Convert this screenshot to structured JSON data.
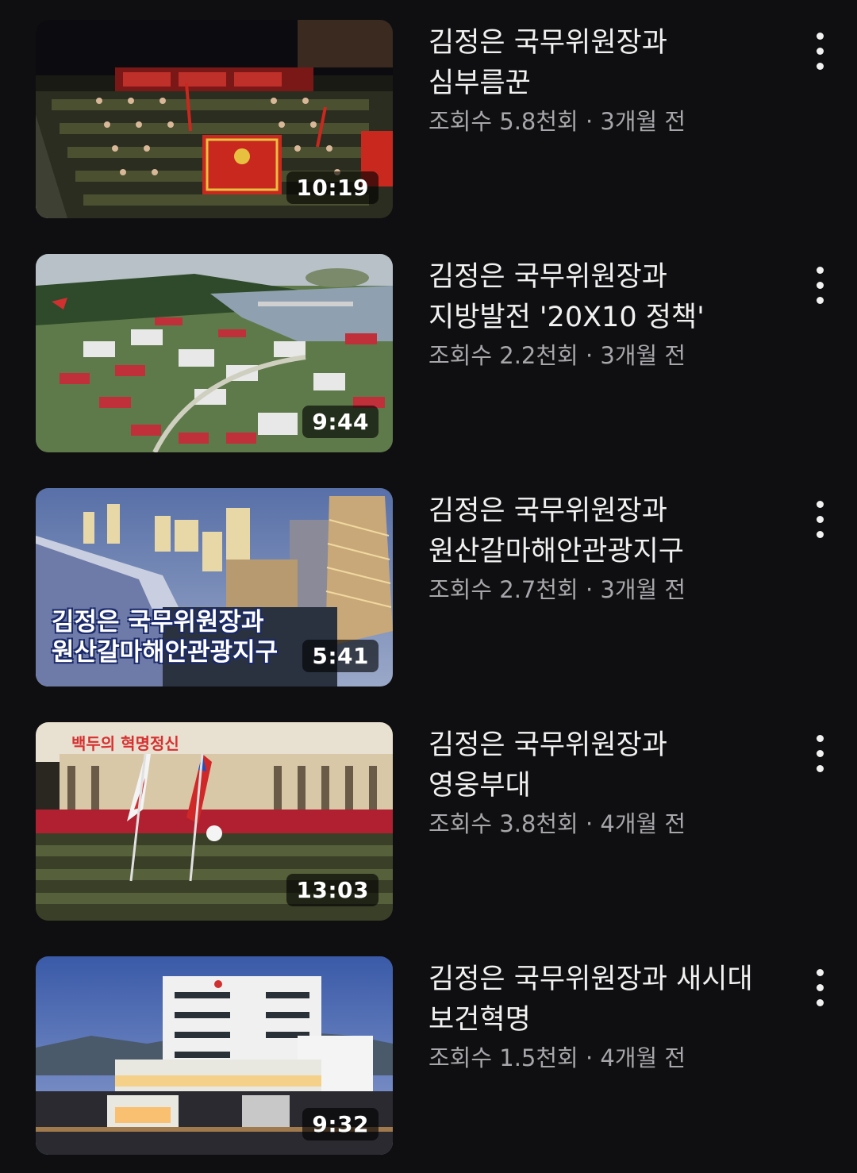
{
  "videos": [
    {
      "title_line1": "김정은 국무위원장과",
      "title_line2": "심부름꾼",
      "views": "조회수 5.8천회",
      "age": "3개월 전",
      "duration": "10:19",
      "thumbnail": "military-parade-night"
    },
    {
      "title_line1": "김정은 국무위원장과",
      "title_line2": "지방발전 '20X10 정책'",
      "views": "조회수 2.2천회",
      "age": "3개월 전",
      "duration": "9:44",
      "thumbnail": "aerial-town-coast"
    },
    {
      "title_line1": "김정은 국무위원장과",
      "title_line2": "원산갈마해안관광지구",
      "views": "조회수 2.7천회",
      "age": "3개월 전",
      "duration": "5:41",
      "thumbnail": "coastal-resort-night",
      "overlay_line1": "김정은 국무위원장과",
      "overlay_line2": "원산갈마해안관광지구"
    },
    {
      "title_line1": "김정은 국무위원장과",
      "title_line2": "영웅부대",
      "views": "조회수 3.8천회",
      "age": "4개월 전",
      "duration": "13:03",
      "thumbnail": "parade-flags-square",
      "banner": "백두의 혁명정신"
    },
    {
      "title_line1": "김정은 국무위원장과 새시대",
      "title_line2": "보건혁명",
      "views": "조회수 1.5천회",
      "age": "4개월 전",
      "duration": "9:32",
      "thumbnail": "hospital-building-dusk"
    }
  ],
  "separator": " · ",
  "menu_icon": "more-vertical-icon"
}
